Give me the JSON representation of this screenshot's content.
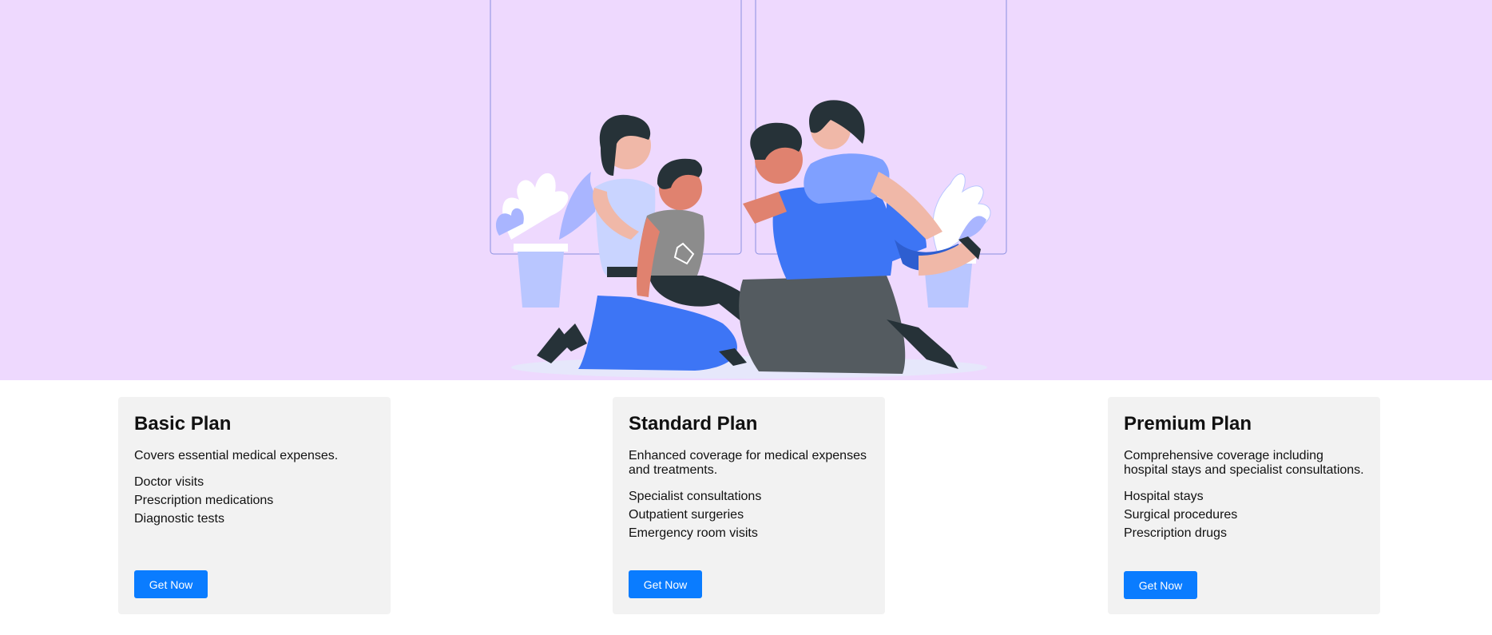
{
  "hero": {
    "background": "#eed9fe",
    "illustration": "family-illustration",
    "accent": "#3d75f5"
  },
  "plans": [
    {
      "title": "Basic Plan",
      "description": "Covers essential medical expenses.",
      "features": [
        "Doctor visits",
        "Prescription medications",
        "Diagnostic tests"
      ],
      "button_label": "Get Now"
    },
    {
      "title": "Standard Plan",
      "description": "Enhanced coverage for medical expenses and treatments.",
      "features": [
        "Specialist consultations",
        "Outpatient surgeries",
        "Emergency room visits"
      ],
      "button_label": "Get Now"
    },
    {
      "title": "Premium Plan",
      "description": "Comprehensive coverage including hospital stays and specialist consultations.",
      "features": [
        "Hospital stays",
        "Surgical procedures",
        "Prescription drugs"
      ],
      "button_label": "Get Now"
    }
  ],
  "colors": {
    "button": "#0a7cff",
    "card": "#f2f2f2"
  }
}
